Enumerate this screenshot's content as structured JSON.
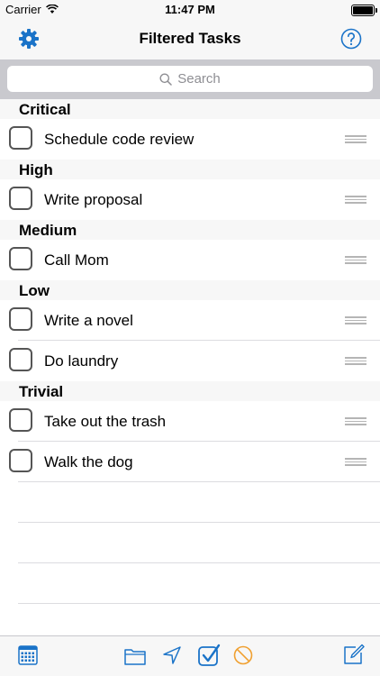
{
  "status_bar": {
    "carrier": "Carrier",
    "time": "11:47 PM"
  },
  "nav": {
    "title": "Filtered Tasks",
    "left_icon": "gear-icon",
    "right_icon": "help-circle-icon"
  },
  "search": {
    "placeholder": "Search"
  },
  "sections": [
    {
      "title": "Critical",
      "tasks": [
        "Schedule code review"
      ]
    },
    {
      "title": "High",
      "tasks": [
        "Write proposal"
      ]
    },
    {
      "title": "Medium",
      "tasks": [
        "Call Mom"
      ]
    },
    {
      "title": "Low",
      "tasks": [
        "Write a novel",
        "Do laundry"
      ]
    },
    {
      "title": "Trivial",
      "tasks": [
        "Take out the trash",
        "Walk the dog"
      ]
    }
  ],
  "toolbar": {
    "icons": [
      "calendar-grid-icon",
      "folder-icon",
      "location-arrow-icon",
      "checkbox-checked-icon",
      "prohibited-icon",
      "compose-icon"
    ]
  },
  "colors": {
    "accent": "#1a73c8",
    "prohibited": "#f0a030",
    "bar": "#f7f7f7",
    "search_bg": "#c9c9ce"
  }
}
